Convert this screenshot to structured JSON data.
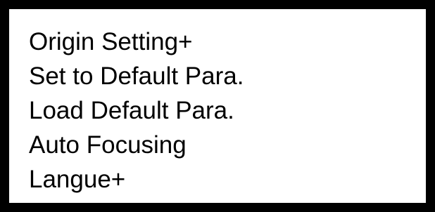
{
  "menu": {
    "items": [
      {
        "label": "Origin Setting+"
      },
      {
        "label": "Set to Default Para."
      },
      {
        "label": "Load Default Para."
      },
      {
        "label": "Auto Focusing"
      },
      {
        "label": "Langue+"
      }
    ]
  },
  "colors": {
    "border": "#000000",
    "background": "#ffffff",
    "text": "#000000"
  }
}
